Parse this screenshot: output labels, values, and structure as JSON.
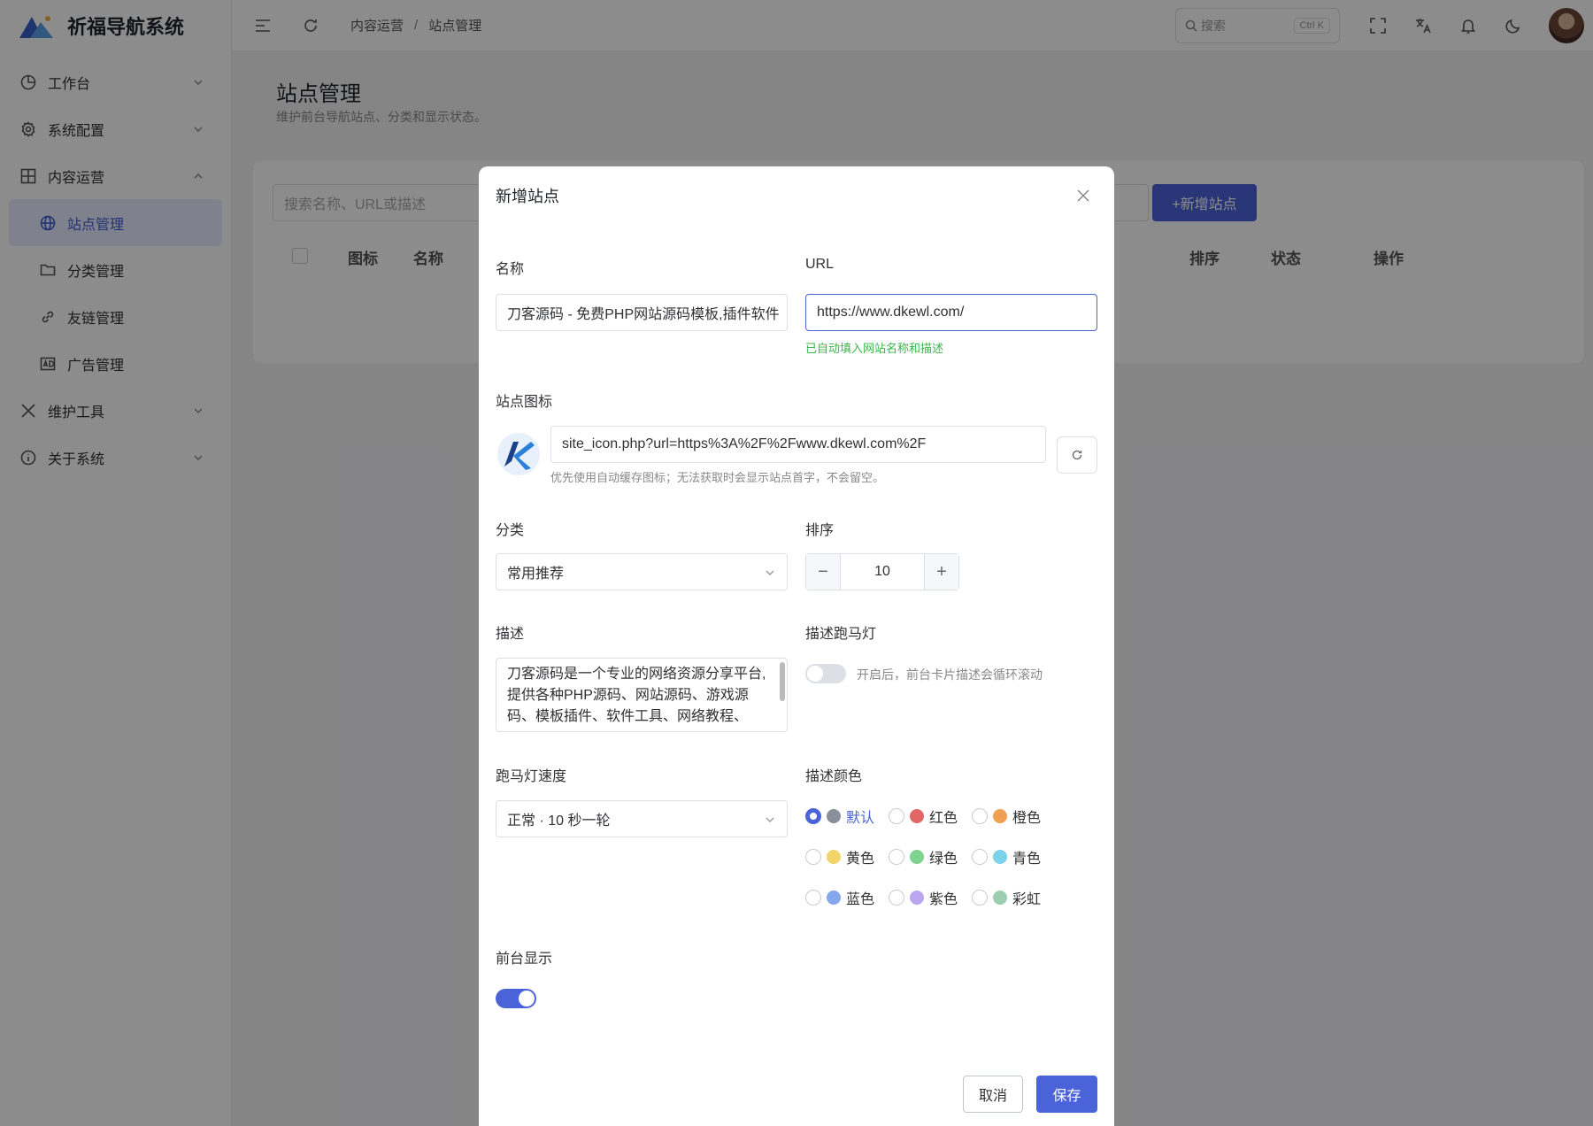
{
  "app": {
    "title": "祈福导航系统"
  },
  "sidebar": {
    "items": [
      {
        "label": "工作台"
      },
      {
        "label": "系统配置"
      },
      {
        "label": "内容运营"
      },
      {
        "label": "维护工具"
      },
      {
        "label": "关于系统"
      }
    ],
    "sub": [
      {
        "label": "站点管理"
      },
      {
        "label": "分类管理"
      },
      {
        "label": "友链管理"
      },
      {
        "label": "广告管理"
      }
    ]
  },
  "header": {
    "breadcrumb": [
      "内容运营",
      "站点管理"
    ],
    "search_placeholder": "搜索",
    "search_kbd": "Ctrl K"
  },
  "page": {
    "title": "站点管理",
    "subtitle": "维护前台导航站点、分类和显示状态。",
    "search_placeholder": "搜索名称、URL或描述",
    "add_button": "+新增站点",
    "columns": [
      "图标",
      "名称",
      "排序",
      "状态",
      "操作"
    ]
  },
  "modal": {
    "title": "新增站点",
    "name_label": "名称",
    "name_value": "刀客源码 - 免费PHP网站源码模板,插件软件",
    "url_label": "URL",
    "url_value": "https://www.dkewl.com/",
    "url_hint": "已自动填入网站名称和描述",
    "icon_label": "站点图标",
    "icon_value": "site_icon.php?url=https%3A%2F%2Fwww.dkewl.com%2F",
    "icon_hint": "优先使用自动缓存图标；无法获取时会显示站点首字，不会留空。",
    "category_label": "分类",
    "category_value": "常用推荐",
    "sort_label": "排序",
    "sort_value": "10",
    "desc_label": "描述",
    "desc_value": "刀客源码是一个专业的网络资源分享平台,提供各种PHP源码、网站源码、游戏源码、模板插件、软件工具、网络教程、",
    "marquee_label": "描述跑马灯",
    "marquee_hint": "开启后，前台卡片描述会循环滚动",
    "marquee_on": false,
    "speed_label": "跑马灯速度",
    "speed_value": "正常 · 10 秒一轮",
    "color_label": "描述颜色",
    "colors": [
      {
        "label": "默认",
        "color": "#8a8f99",
        "checked": true
      },
      {
        "label": "红色",
        "color": "#e06666",
        "checked": false
      },
      {
        "label": "橙色",
        "color": "#f0a050",
        "checked": false
      },
      {
        "label": "黄色",
        "color": "#f2d46b",
        "checked": false
      },
      {
        "label": "绿色",
        "color": "#7fd38f",
        "checked": false
      },
      {
        "label": "青色",
        "color": "#7ad3ea",
        "checked": false
      },
      {
        "label": "蓝色",
        "color": "#86a7ee",
        "checked": false
      },
      {
        "label": "紫色",
        "color": "#b9a6ef",
        "checked": false
      },
      {
        "label": "彩虹",
        "color": "#9ccfb0",
        "checked": false
      }
    ],
    "visible_label": "前台显示",
    "visible_on": true,
    "cancel_label": "取消",
    "save_label": "保存"
  },
  "theme": {
    "accent": "#4a63d9",
    "success": "#3bb54a"
  }
}
